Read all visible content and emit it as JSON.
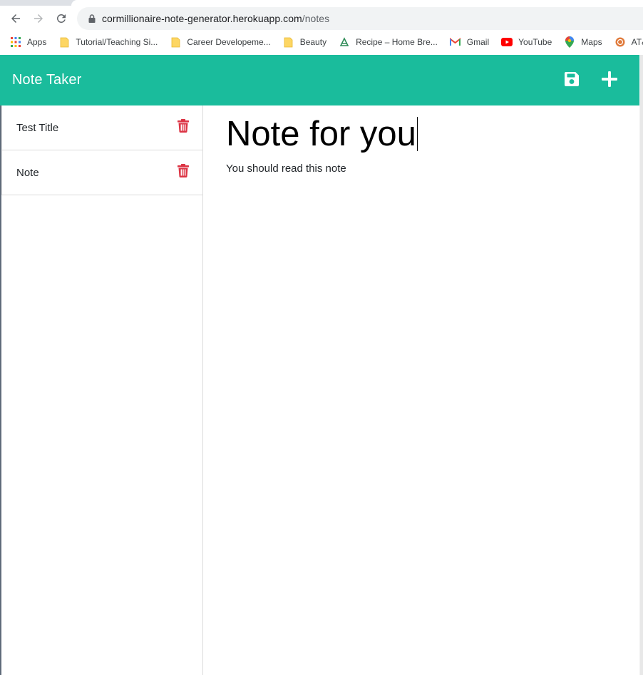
{
  "browser": {
    "url_host": "cormillionaire-note-generator.herokuapp.com",
    "url_path": "/notes",
    "bookmarks": [
      {
        "label": "Apps",
        "icon": "apps-grid-icon"
      },
      {
        "label": "Tutorial/Teaching Si...",
        "icon": "folder-icon"
      },
      {
        "label": "Career Developeme...",
        "icon": "folder-icon"
      },
      {
        "label": "Beauty",
        "icon": "folder-icon"
      },
      {
        "label": "Recipe – Home Bre...",
        "icon": "recipe-site-icon"
      },
      {
        "label": "Gmail",
        "icon": "gmail-icon"
      },
      {
        "label": "YouTube",
        "icon": "youtube-icon"
      },
      {
        "label": "Maps",
        "icon": "maps-icon"
      },
      {
        "label": "AT&T -",
        "icon": "att-icon"
      }
    ]
  },
  "app": {
    "title": "Note Taker",
    "accent_color": "#1abc9c",
    "delete_color": "#dc3545",
    "header_icons": [
      "save-icon",
      "plus-icon"
    ]
  },
  "sidebar": {
    "notes": [
      {
        "title": "Test Title"
      },
      {
        "title": "Note"
      }
    ]
  },
  "editor": {
    "title": "Note for you",
    "body": "You should read this note"
  }
}
